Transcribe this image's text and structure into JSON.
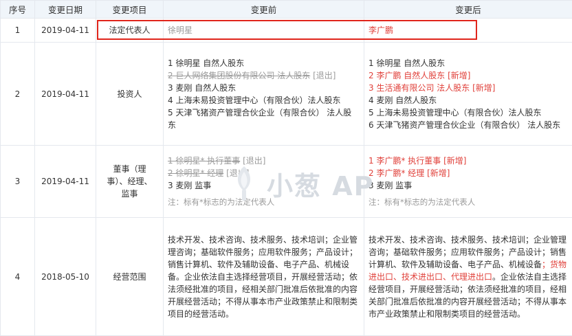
{
  "header": {
    "col_index": "序号",
    "col_date": "变更日期",
    "col_item": "变更项目",
    "col_before": "变更前",
    "col_after": "变更后"
  },
  "rows": [
    {
      "index": "1",
      "date": "2019-04-11",
      "item": "法定代表人",
      "before": [
        {
          "text": "徐明星",
          "style": "gray"
        }
      ],
      "after": [
        {
          "text": "李广鹏",
          "style": "red"
        }
      ]
    },
    {
      "index": "2",
      "date": "2019-04-11",
      "item": "投资人",
      "before": [
        {
          "text": "1 徐明星 自然人股东",
          "style": "normal"
        },
        {
          "text": "2 巨人网络集团股份有限公司 法人股东",
          "style": "del",
          "tag": " [退出]"
        },
        {
          "text": "3 麦刚 自然人股东",
          "style": "normal"
        },
        {
          "text": "4 上海未易投资管理中心（有限合伙）法人股东",
          "style": "normal"
        },
        {
          "text": "5 天津飞猪资产管理合伙企业（有限合伙） 法人股东",
          "style": "normal"
        }
      ],
      "after": [
        {
          "text": "1 徐明星 自然人股东",
          "style": "normal"
        },
        {
          "text": "2 李广鹏 自然人股东 [新增]",
          "style": "red"
        },
        {
          "text": "3 生活通有限公司 法人股东 [新增]",
          "style": "red"
        },
        {
          "text": "4 麦刚 自然人股东",
          "style": "normal"
        },
        {
          "text": "5 上海未易投资管理中心（有限合伙）法人股东",
          "style": "normal"
        },
        {
          "text": "6 天津飞猪资产管理合伙企业（有限合伙） 法人股东",
          "style": "normal"
        }
      ]
    },
    {
      "index": "3",
      "date": "2019-04-11",
      "item": "董事（理事）、经理、监事",
      "before": [
        {
          "text": "1 徐明星* 执行董事",
          "style": "del",
          "tag": " [退出]"
        },
        {
          "text": "2 徐明星* 经理",
          "style": "del",
          "tag": " [退出]"
        },
        {
          "text": "3 麦刚 监事",
          "style": "normal"
        }
      ],
      "before_note": "注：标有*标志的为法定代表人",
      "after": [
        {
          "text": "1 李广鹏* 执行董事 [新增]",
          "style": "red"
        },
        {
          "text": "2 李广鹏* 经理 [新增]",
          "style": "red"
        },
        {
          "text": "3 麦刚 监事",
          "style": "normal"
        }
      ],
      "after_note": "注：标有*标志的为法定代表人"
    },
    {
      "index": "4",
      "date": "2018-05-10",
      "item": "经营范围",
      "before_text": "技术开发、技术咨询、技术服务、技术培训；企业管理咨询；基础软件服务；应用软件服务；产品设计；销售计算机、软件及辅助设备、电子产品、机械设备。企业依法自主选择经营项目，开展经营活动；依法须经批准的项目，经相关部门批准后依批准的内容开展经营活动；不得从事本市产业政策禁止和限制类项目的经营活动。",
      "after_text_1": "技术开发、技术咨询、技术服务、技术培训；企业管理咨询；基础软件服务；应用软件服务；产品设计；销售计算机、软件及辅助设备、电子产品、机械设备",
      "after_text_red": "；货物进出口、技术进出口、代理进出口",
      "after_text_2": "。企业依法自主选择经营项目，开展经营活动；依法须经批准的项目，经相关部门批准后依批准的内容开展经营活动；不得从事本市产业政策禁止和限制类项目的经营活动。"
    }
  ],
  "watermark": {
    "text": "小葱 AP"
  },
  "colors": {
    "red": "#e0403a",
    "header_bg": "#f0f5fa",
    "highlight_box": "#e0251b"
  }
}
